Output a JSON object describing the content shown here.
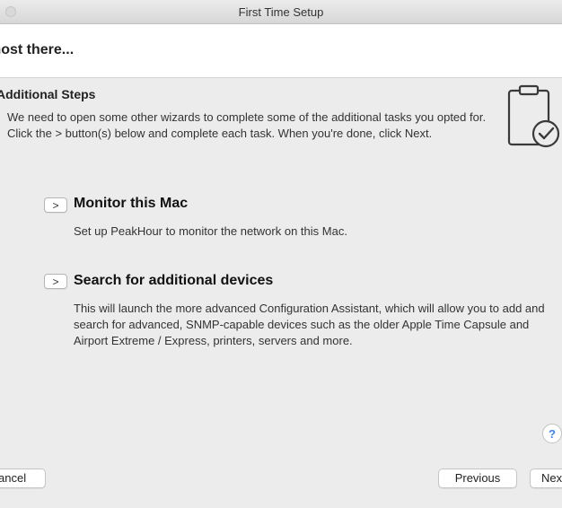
{
  "window": {
    "title": "First Time Setup"
  },
  "header": {
    "heading": "most there..."
  },
  "content": {
    "section_title": "Additional Steps",
    "description": "We need to open some other wizards to complete some of the additional tasks you opted for. Click the > button(s) below and complete each task. When you're done, click Next.",
    "icon": "clipboard-check-icon"
  },
  "steps": [
    {
      "toggle": ">",
      "title": "Monitor this Mac",
      "description": "Set up PeakHour to monitor the network on this Mac."
    },
    {
      "toggle": ">",
      "title": "Search for additional devices",
      "description": "This will launch the more advanced Configuration Assistant, which will allow you to add and search for advanced, SNMP-capable devices such as the older Apple Time Capsule and Airport Extreme / Express, printers, servers and more."
    }
  ],
  "help": {
    "label": "?"
  },
  "footer": {
    "cancel_label": "ancel",
    "previous_label": "Previous",
    "next_label": "Nex"
  },
  "colors": {
    "accent": "#3b82f6",
    "header_bg": "#ffffff",
    "window_bg": "#ececec"
  }
}
